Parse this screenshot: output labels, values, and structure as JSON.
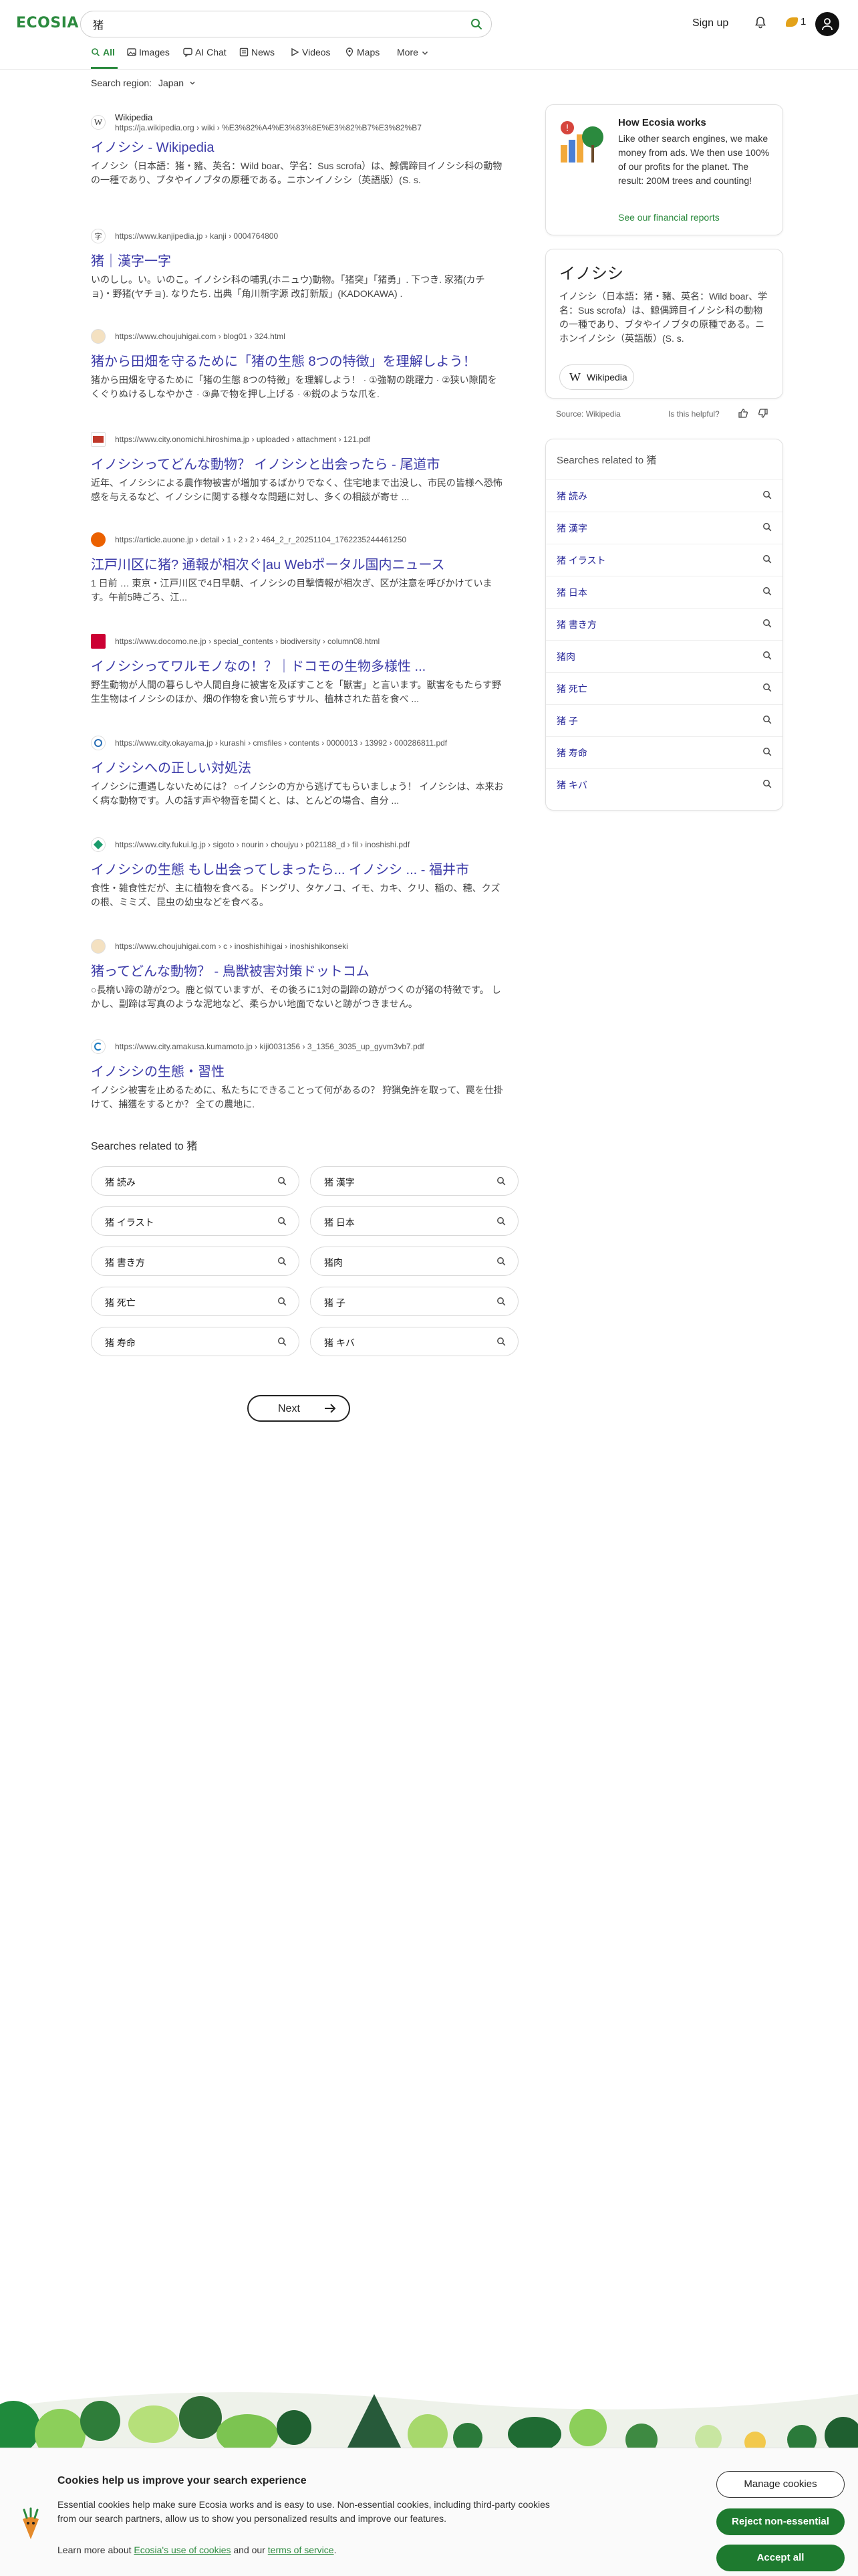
{
  "header": {
    "logo": "ECOSIA",
    "search_value": "猪",
    "signup_label": "Sign up",
    "seed_count": "1"
  },
  "tabs": [
    {
      "label": "All",
      "icon": "search-icon"
    },
    {
      "label": "Images",
      "icon": "image-icon"
    },
    {
      "label": "AI Chat",
      "icon": "chat-icon"
    },
    {
      "label": "News",
      "icon": "news-icon"
    },
    {
      "label": "Videos",
      "icon": "play-icon"
    },
    {
      "label": "Maps",
      "icon": "map-pin-icon"
    },
    {
      "label": "More",
      "icon": "chevron-down-icon"
    }
  ],
  "search_region": {
    "label": "Search region:",
    "value": "Japan"
  },
  "results": [
    {
      "site": "Wikipedia",
      "url": "https://ja.wikipedia.org › wiki › %E3%82%A4%E3%83%8E%E3%82%B7%E3%82%B7",
      "title": "イノシシ - Wikipedia",
      "snippet": "イノシシ（日本語：猪・豬、英名：Wild boar、学名：Sus scrofa）は、鯨偶蹄目イノシシ科の動物の一種であり、ブタやイノブタの原種である。ニホンイノシシ（英語版）(S. s."
    },
    {
      "url": "https://www.kanjipedia.jp › kanji › 0004764800",
      "title": "猪｜漢字一字",
      "snippet": "いのしし。い。いのこ。イノシシ科の哺乳(ホニュウ)動物。「猪突」「猪勇」. 下つき. 家猪(カチョ)・野猪(ヤチョ). なりたち. 出典「角川新字源 改訂新版」(KADOKAWA) ."
    },
    {
      "url": "https://www.choujuhigai.com › blog01 › 324.html",
      "title": "猪から田畑を守るために「猪の生態 8つの特徴」を理解しよう！",
      "snippet": "猪から田畑を守るために「猪の生態 8つの特徴」を理解しよう！ · ①強靭の跳躍力 · ②狭い隙間をくぐりぬけるしなやかさ · ③鼻で物を押し上げる · ④鋭のような爪を."
    },
    {
      "url": "https://www.city.onomichi.hiroshima.jp › uploaded › attachment › 121.pdf",
      "title": "イノシシってどんな動物？ イノシシと出会ったら - 尾道市",
      "snippet": "近年、イノシシによる農作物被害が増加するばかりでなく、住宅地まで出没し、市民の皆様へ恐怖感を与えるなど、イノシシに関する様々な問題に対し、多くの相談が寄せ ..."
    },
    {
      "url": "https://article.auone.jp › detail › 1 › 2 › 2 › 464_2_r_20251104_1762235244461250",
      "title": "江戸川区に猪? 通報が相次ぐ|au Webポータル国内ニュース",
      "snippet": "1 日前 … 東京・江戸川区で4日早朝、イノシシの目撃情報が相次ぎ、区が注意を呼びかけています。午前5時ごろ、江..."
    },
    {
      "url": "https://www.docomo.ne.jp › special_contents › biodiversity › column08.html",
      "title": "イノシシってワルモノなの！？｜ドコモの生物多様性 ...",
      "snippet": "野生動物が人間の暮らしや人間自身に被害を及ぼすことを「獣害」と言います。獣害をもたらす野生生物はイノシシのほか、畑の作物を食い荒らすサル、植林された苗を食べ ..."
    },
    {
      "url": "https://www.city.okayama.jp › kurashi › cmsfiles › contents › 0000013 › 13992 › 000286811.pdf",
      "title": "イノシシへの正しい対処法",
      "snippet": "イノシシに遭遇しないためには？ ○イノシシの方から逃げてもらいましょう！ イノシシは、本来お く病な動物です。人の話す声や物音を聞くと、は、とんどの場合、自分 ..."
    },
    {
      "url": "https://www.city.fukui.lg.jp › sigoto › nourin › choujyu › p021188_d › fil › inoshishi.pdf",
      "title": "イノシシの生態 もし出会ってしまったら... イノシシ ... - 福井市",
      "snippet": "食性・雑食性だが、主に植物を食べる。ドングリ、タケノコ、イモ、カキ、クリ、稲の、穂、クズの根、ミミズ、昆虫の幼虫などを食べる。"
    },
    {
      "url": "https://www.choujuhigai.com › c › inoshishihigai › inoshishikonseki",
      "title": "猪ってどんな動物？ - 鳥獣被害対策ドットコム",
      "snippet": "○長楕い蹄の跡が2つ。鹿と似ていますが、その後ろに1対の副蹄の跡がつくのが猪の特徴です。 しかし、副蹄は写真のような泥地など、柔らかい地面でないと跡がつきません。"
    },
    {
      "url": "https://www.city.amakusa.kumamoto.jp › kiji0031356 › 3_1356_3035_up_gyvm3vb7.pdf",
      "title": "イノシシの生態・習性",
      "snippet": "イノシシ被害を止めるために、私たちにできることって何があるの？ 狩猟免許を取って、罠を仕掛けて、捕獲をするとか？ 全ての農地に."
    }
  ],
  "related_bottom": {
    "heading": "Searches related to 猪",
    "items": [
      "猪 読み",
      "猪 漢字",
      "猪 イラスト",
      "猪 日本",
      "猪 書き方",
      "猪肉",
      "猪 死亡",
      "猪 子",
      "猪 寿命",
      "猪 キバ"
    ]
  },
  "next_label": "Next",
  "how_card": {
    "title": "How Ecosia works",
    "body": "Like other search engines, we make money from ads. We then use 100% of our profits for the planet. The result: 200M trees and counting!",
    "link": "See our financial reports"
  },
  "knowledge_panel": {
    "title": "イノシシ",
    "body": "イノシシ（日本語：猪・豬、英名：Wild boar、学名：Sus scrofa）は、鯨偶蹄目イノシシ科の動物の一種であり、ブタやイノブタの原種である。ニホンイノシシ（英語版）(S. s.",
    "wiki_label": "Wikipedia",
    "source": "Source: Wikipedia",
    "helpful": "Is this helpful?"
  },
  "related_sidebar": {
    "heading": "Searches related to 猪",
    "items": [
      "猪 読み",
      "猪 漢字",
      "猪 イラスト",
      "猪 日本",
      "猪 書き方",
      "猪肉",
      "猪 死亡",
      "猪 子",
      "猪 寿命",
      "猪 キバ"
    ]
  },
  "cookie": {
    "title": "Cookies help us improve your search experience",
    "text": "Essential cookies help make sure Ecosia works and is easy to use. Non-essential cookies, including third-party cookies from our search partners, allow us to show you personalized results and improve our features.",
    "learn_prefix": "Learn more about ",
    "link1": "Ecosia's use of cookies",
    "and": " and our ",
    "link2": "terms of service",
    "period": ".",
    "manage": "Manage cookies",
    "reject": "Reject non-essential",
    "accept": "Accept all"
  },
  "colors": {
    "brand_green": "#2b8a3e",
    "link_blue": "#3b3aa8",
    "button_green": "#1e7a2f"
  }
}
